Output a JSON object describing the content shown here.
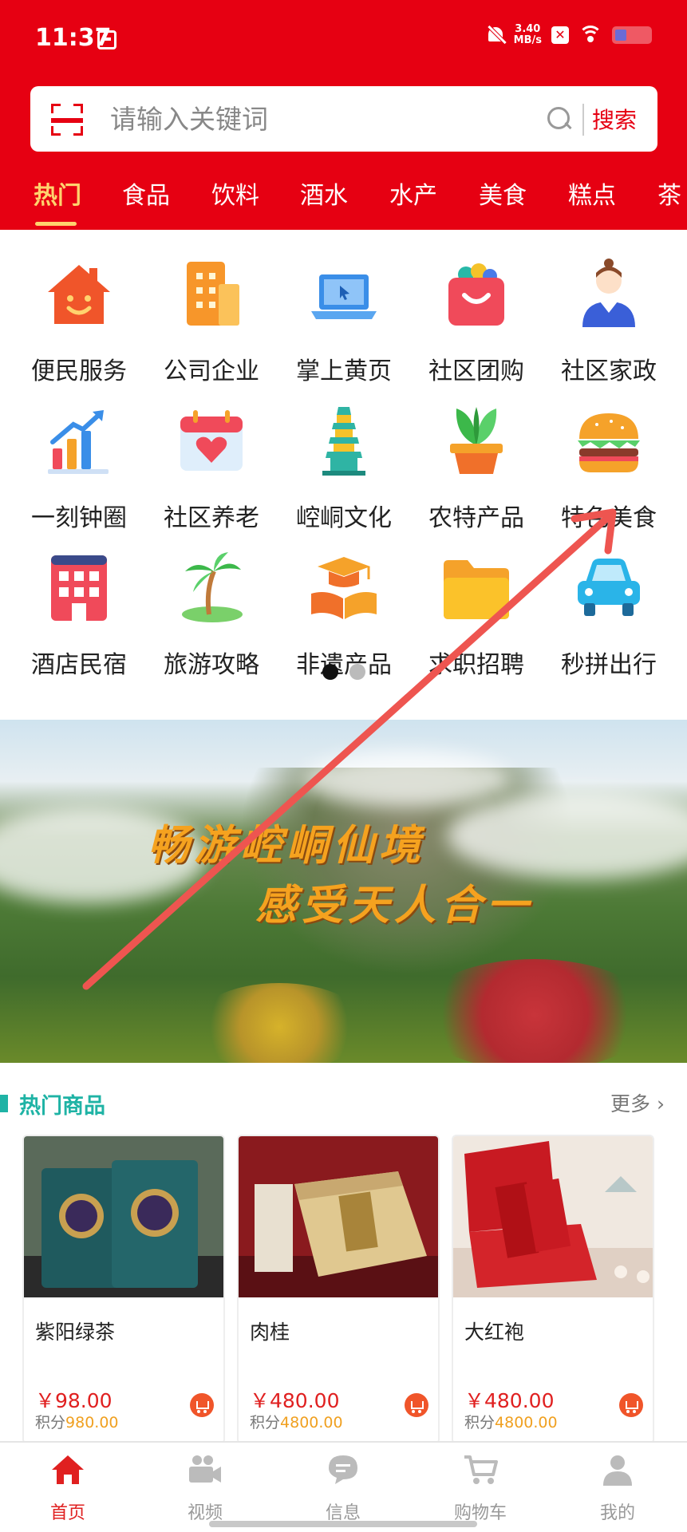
{
  "status_bar": {
    "time": "11:37",
    "net_speed_value": "3.40",
    "net_speed_unit": "MB/s"
  },
  "search": {
    "placeholder": "请输入关键词",
    "button_label": "搜索"
  },
  "category_tabs": {
    "items": [
      {
        "label": "热门",
        "active": true
      },
      {
        "label": "食品"
      },
      {
        "label": "饮料"
      },
      {
        "label": "酒水"
      },
      {
        "label": "水产"
      },
      {
        "label": "美食"
      },
      {
        "label": "糕点"
      },
      {
        "label": "茶"
      }
    ]
  },
  "services": {
    "items": [
      {
        "label": "便民服务",
        "icon": "house-smile-icon"
      },
      {
        "label": "公司企业",
        "icon": "building-icon"
      },
      {
        "label": "掌上黄页",
        "icon": "laptop-icon"
      },
      {
        "label": "社区团购",
        "icon": "shopping-bag-icon"
      },
      {
        "label": "社区家政",
        "icon": "housekeeper-icon"
      },
      {
        "label": "一刻钟圈",
        "icon": "bar-chart-icon"
      },
      {
        "label": "社区养老",
        "icon": "calendar-heart-icon"
      },
      {
        "label": "崆峒文化",
        "icon": "pagoda-icon"
      },
      {
        "label": "农特产品",
        "icon": "plant-pot-icon"
      },
      {
        "label": "特色美食",
        "icon": "burger-icon"
      },
      {
        "label": "酒店民宿",
        "icon": "hotel-icon"
      },
      {
        "label": "旅游攻略",
        "icon": "palm-island-icon"
      },
      {
        "label": "非遗产品",
        "icon": "graduation-book-icon"
      },
      {
        "label": "求职招聘",
        "icon": "folder-icon"
      },
      {
        "label": "秒拼出行",
        "icon": "car-icon"
      }
    ],
    "pager": {
      "pages": 2,
      "current": 1
    }
  },
  "banner": {
    "line1": "畅游崆峒仙境",
    "line2": "感受天人合一"
  },
  "hot_products": {
    "title": "热门商品",
    "more_label": "更多",
    "points_label": "积分",
    "items": [
      {
        "name": "紫阳绿茶",
        "price": "￥98.00",
        "points": "980.00"
      },
      {
        "name": "肉桂",
        "price": "￥480.00",
        "points": "4800.00"
      },
      {
        "name": "大红袍",
        "price": "￥480.00",
        "points": "4800.00"
      }
    ]
  },
  "bottom_nav": {
    "items": [
      {
        "label": "首页",
        "icon": "home-icon",
        "active": true
      },
      {
        "label": "视频",
        "icon": "video-camera-icon"
      },
      {
        "label": "信息",
        "icon": "message-icon"
      },
      {
        "label": "购物车",
        "icon": "cart-icon"
      },
      {
        "label": "我的",
        "icon": "user-icon"
      }
    ]
  },
  "colors": {
    "brand_red": "#e60012",
    "active_tab": "#ffd36e",
    "section_teal": "#1fb3a5",
    "price_red": "#e02020",
    "points_orange": "#f0a020"
  }
}
